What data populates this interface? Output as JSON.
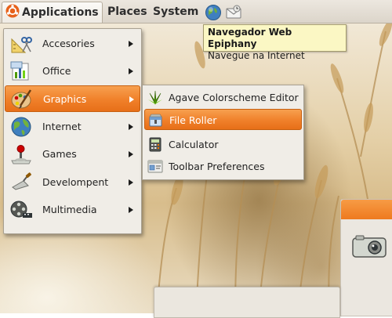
{
  "panel": {
    "menus": {
      "applications": "Applications",
      "places": "Places",
      "system": "System"
    },
    "launchers": [
      {
        "icon": "epiphany-globe-icon"
      },
      {
        "icon": "email-icon"
      }
    ]
  },
  "tooltip": {
    "title": "Navegador Web Epiphany",
    "subtitle": "Navegue na Internet"
  },
  "applications_menu": {
    "items": [
      {
        "label": "Accesories",
        "icon": "accessories-icon",
        "has_submenu": true
      },
      {
        "label": "Office",
        "icon": "office-icon",
        "has_submenu": true
      },
      {
        "label": "Graphics",
        "icon": "graphics-palette-icon",
        "has_submenu": true,
        "active": true
      },
      {
        "label": "Internet",
        "icon": "globe-icon",
        "has_submenu": true
      },
      {
        "label": "Games",
        "icon": "joystick-icon",
        "has_submenu": true
      },
      {
        "label": "Develompent",
        "icon": "trowel-icon",
        "has_submenu": true
      },
      {
        "label": "Multimedia",
        "icon": "film-reel-icon",
        "has_submenu": true
      }
    ]
  },
  "graphics_submenu": {
    "items": [
      {
        "label": "Agave Colorscheme Editor",
        "icon": "agave-icon"
      },
      {
        "label": "File Roller",
        "icon": "file-roller-icon",
        "active": true
      },
      {
        "label": "Calculator",
        "icon": "calculator-icon"
      },
      {
        "label": "Toolbar Preferences",
        "icon": "toolbar-preferences-icon"
      }
    ]
  },
  "colors": {
    "highlight": "#f0802a",
    "menu_bg": "#f0ede7",
    "panel_bg": "#dcd5ca",
    "tooltip_bg": "#fbf7c4"
  }
}
